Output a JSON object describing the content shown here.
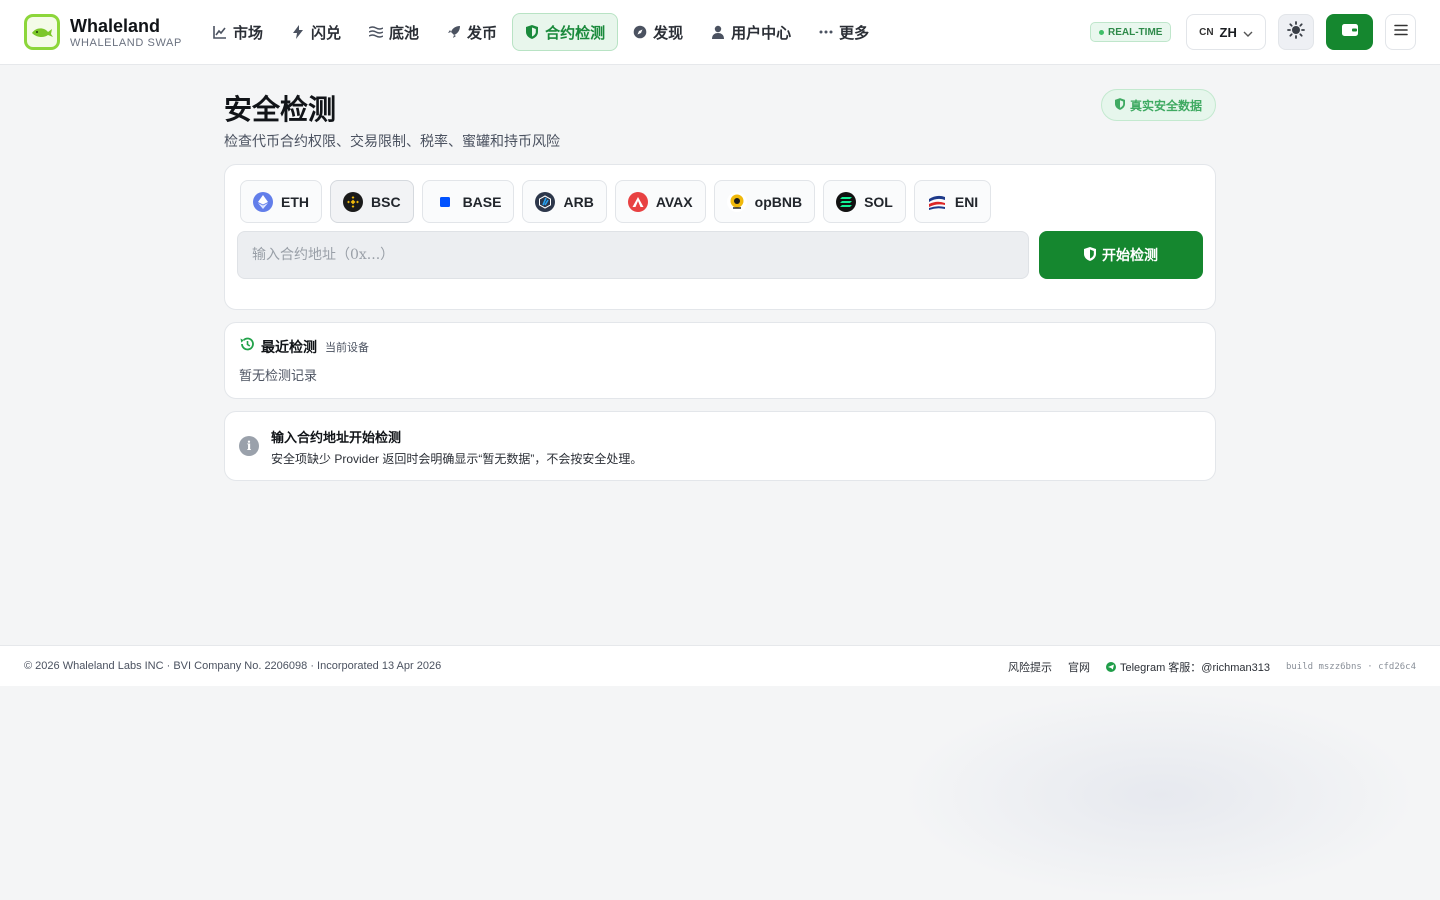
{
  "header": {
    "brand_name": "Whaleland",
    "brand_sub": "WHALELAND SWAP",
    "nav": [
      {
        "label": "市场",
        "icon": "chart-line-icon"
      },
      {
        "label": "闪兑",
        "icon": "bolt-icon"
      },
      {
        "label": "底池",
        "icon": "pool-waves-icon"
      },
      {
        "label": "发币",
        "icon": "rocket-icon"
      },
      {
        "label": "合约检测",
        "icon": "shield-icon",
        "active": true
      },
      {
        "label": "发现",
        "icon": "compass-icon"
      },
      {
        "label": "用户中心",
        "icon": "user-icon"
      },
      {
        "label": "更多",
        "icon": "ellipsis-icon"
      }
    ],
    "realtime_badge": "REAL-TIME",
    "lang_flag": "CN",
    "lang_code": "ZH"
  },
  "main": {
    "title": "安全检测",
    "subtitle": "检查代币合约权限、交易限制、税率、蜜罐和持币风险",
    "data_badge": "真实安全数据",
    "chains": [
      {
        "label": "ETH",
        "color": "#627eea"
      },
      {
        "label": "BSC",
        "color": "#f0b90b",
        "selected": true
      },
      {
        "label": "BASE",
        "color": "#0052ff"
      },
      {
        "label": "ARB",
        "color": "#28a0f0"
      },
      {
        "label": "AVAX",
        "color": "#e84142"
      },
      {
        "label": "opBNB",
        "color": "#f0b90b"
      },
      {
        "label": "SOL",
        "color": "#14f195"
      },
      {
        "label": "ENI",
        "color": "#1e3a8a"
      }
    ],
    "address_placeholder": "输入合约地址（0x...）",
    "start_button": "开始检测",
    "recent": {
      "title": "最近检测",
      "tag": "当前设备",
      "empty": "暂无检测记录"
    },
    "info": {
      "title": "输入合约地址开始检测",
      "text": "安全项缺少 Provider 返回时会明确显示“暂无数据”，不会按安全处理。"
    }
  },
  "footer": {
    "copyright": "© 2026 Whaleland Labs INC · BVI Company No. 2206098 · Incorporated 13 Apr 2026",
    "risk": "风险提示",
    "official": "官网",
    "telegram": "Telegram 客服：@richman313",
    "build": "build mszz6bns · cfd26c4"
  },
  "colors": {
    "accent": "#15872f",
    "active_nav_bg": "#e8f6ec",
    "badge_green": "#3faa62"
  }
}
